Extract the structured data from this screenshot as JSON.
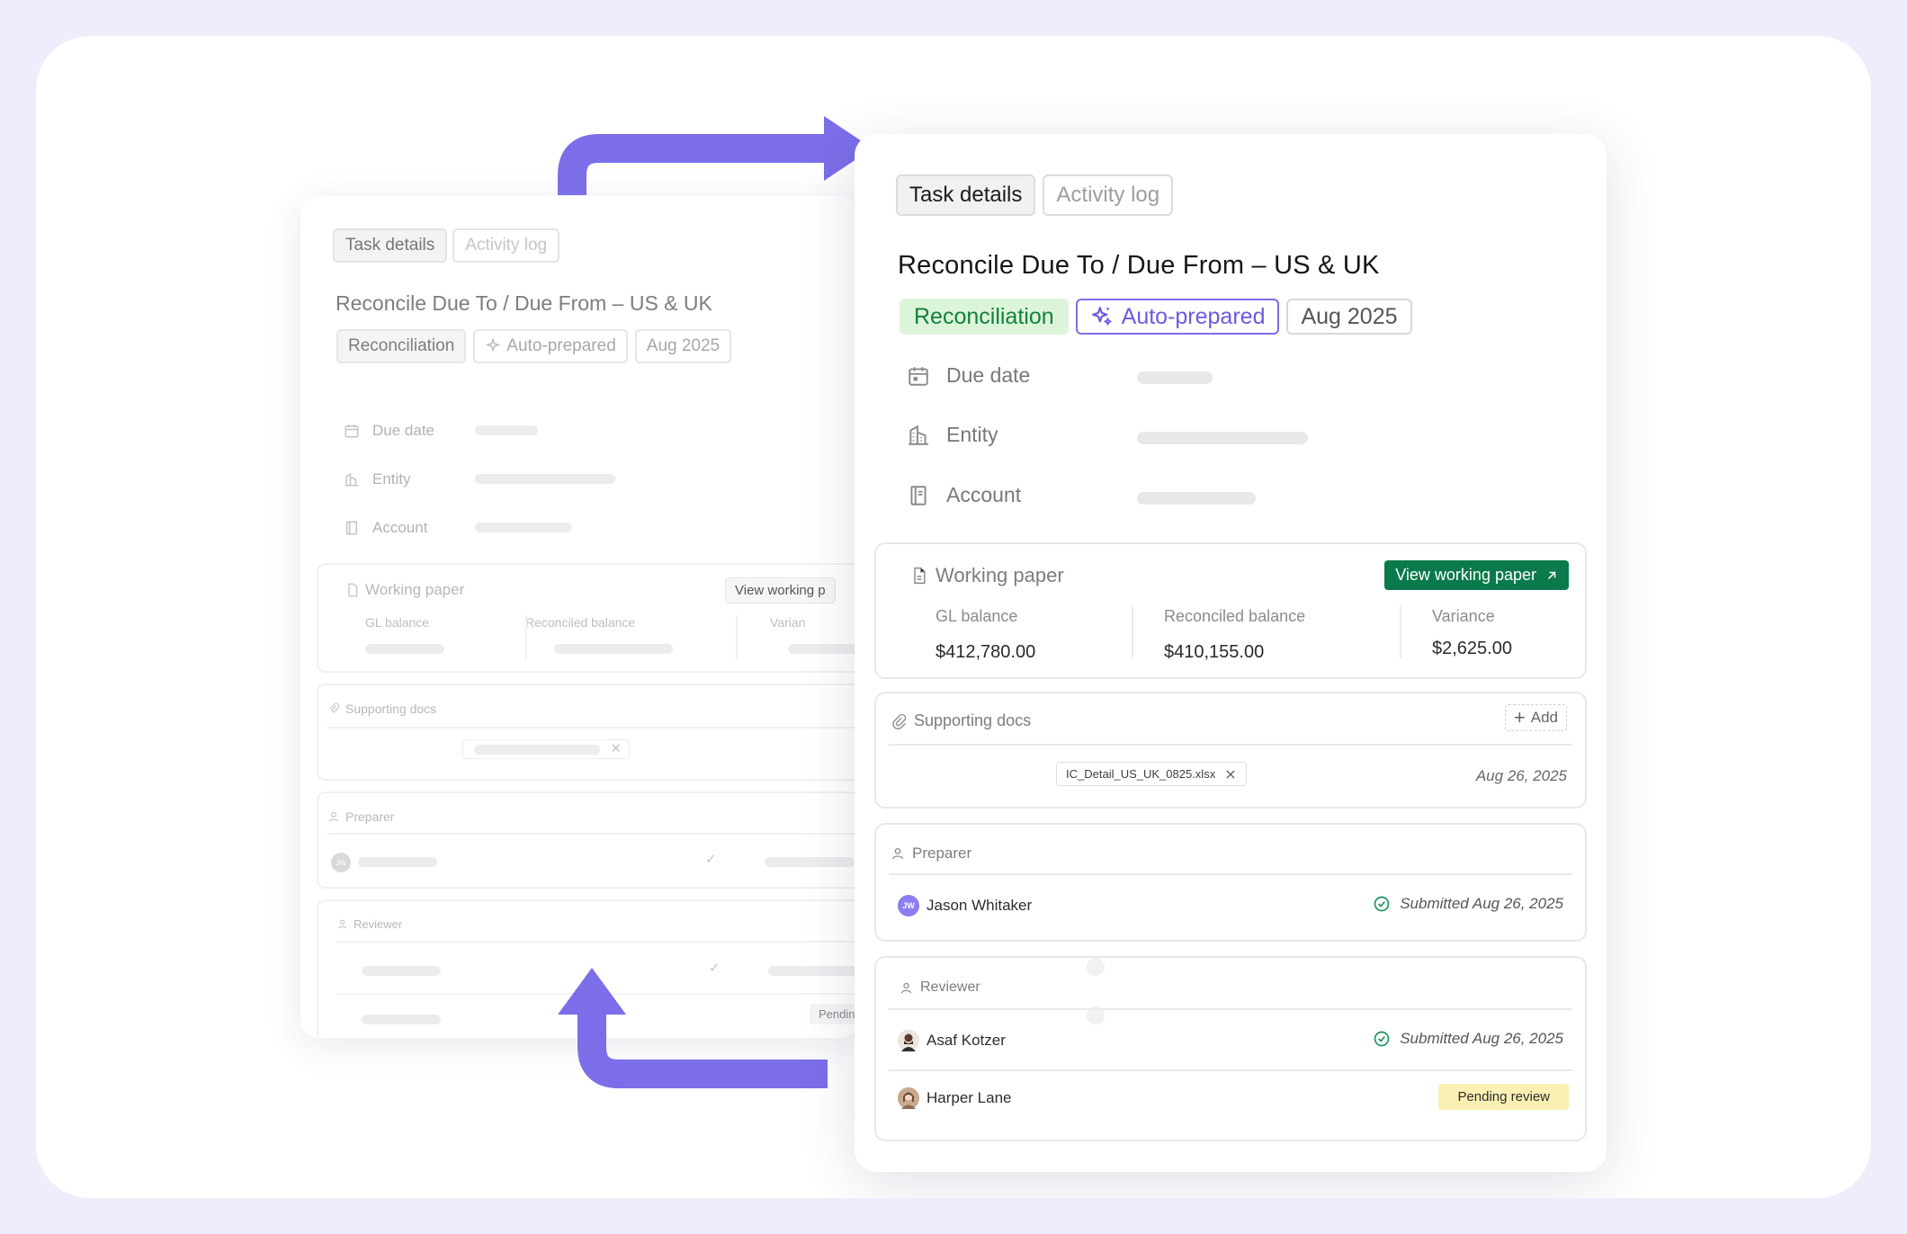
{
  "tabs": {
    "active": "Task details",
    "inactive": "Activity log"
  },
  "task": {
    "title": "Reconcile Due To / Due From – US & UK",
    "tag_type": "Reconciliation",
    "tag_auto": "Auto-prepared",
    "tag_period": "Aug 2025"
  },
  "fields": {
    "due_date": "Due date",
    "entity": "Entity",
    "account": "Account"
  },
  "working_paper": {
    "heading": "Working paper",
    "button": "View working paper",
    "gl_label": "GL balance",
    "gl_value": "$412,780.00",
    "rec_label": "Reconciled balance",
    "rec_value": "$410,155.00",
    "var_label": "Variance",
    "var_value": "$2,625.00"
  },
  "supporting_docs": {
    "heading": "Supporting docs",
    "add": "Add",
    "file": "IC_Detail_US_UK_0825.xlsx",
    "date": "Aug 26, 2025"
  },
  "preparer": {
    "heading": "Preparer",
    "name": "Jason Whitaker",
    "initials": "JW",
    "status": "Submitted Aug 26, 2025"
  },
  "reviewer": {
    "heading": "Reviewer",
    "r1_name": "Asaf Kotzer",
    "r1_status": "Submitted Aug 26, 2025",
    "r2_name": "Harper Lane",
    "r2_status": "Pending review"
  },
  "bg": {
    "view_wp": "View working p",
    "variance": "Varian",
    "pending": "Pendin",
    "initials": "JW"
  },
  "colors": {
    "accent": "#7b6ee8",
    "green": "#0a7a4c",
    "pending": "#fbf0b3",
    "frame": "#efedfb"
  }
}
